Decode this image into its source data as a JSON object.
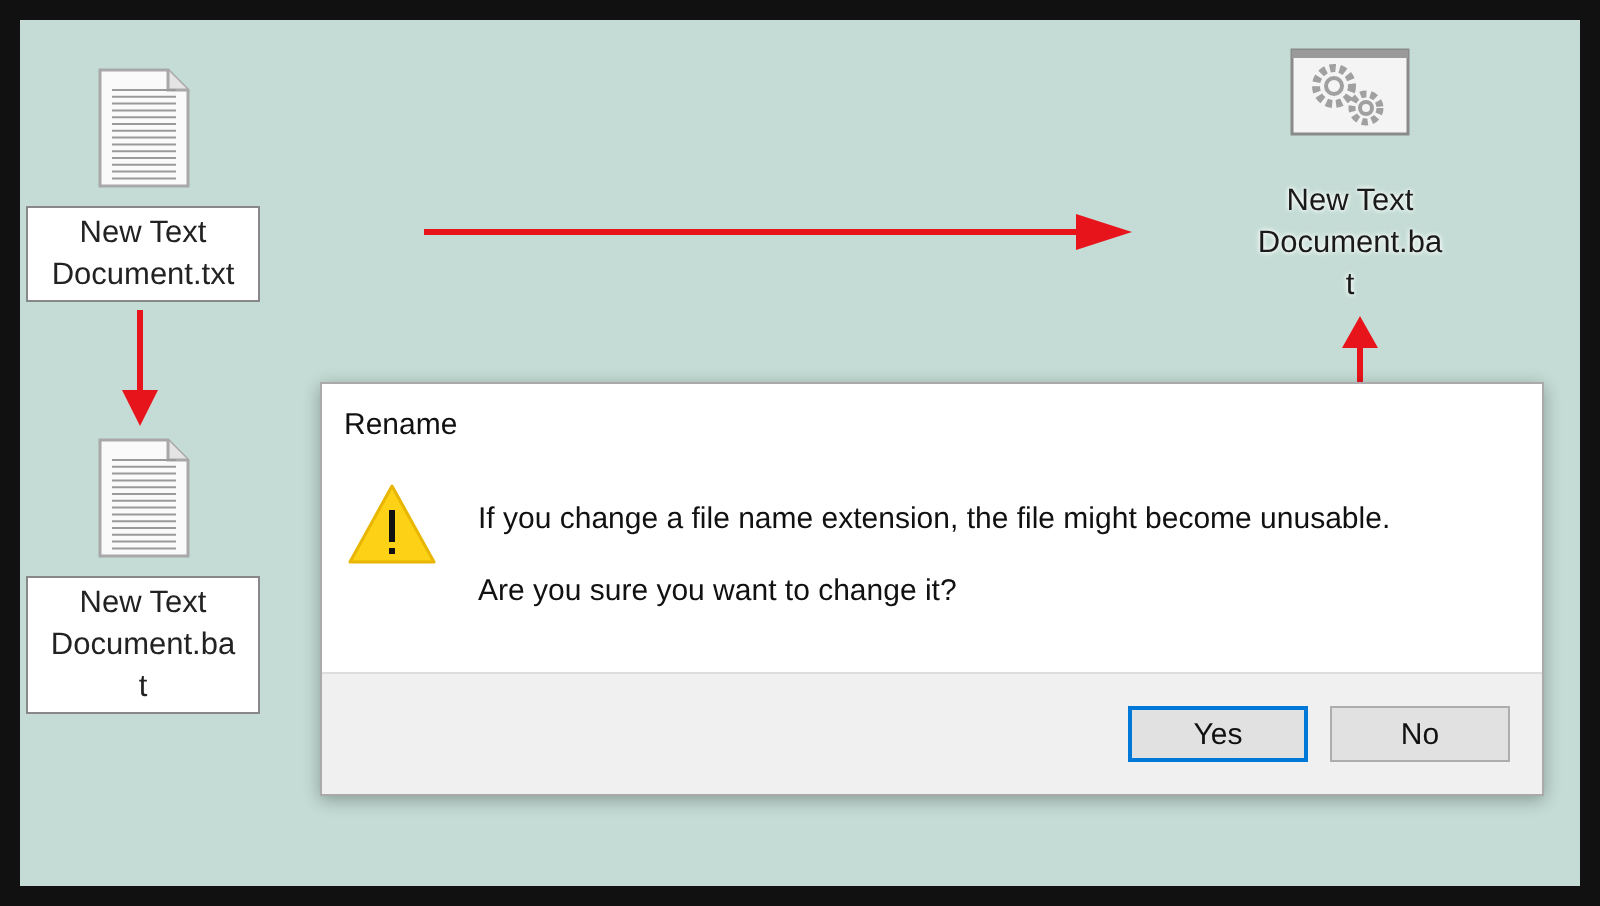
{
  "desktop_icons": [
    {
      "kind": "text",
      "label": "New Text Document.txt",
      "editing": true
    },
    {
      "kind": "text",
      "label": "New Text Document.ba\nt",
      "editing": true
    },
    {
      "kind": "batch",
      "label": "New Text Document.ba\nt",
      "editing": false
    }
  ],
  "dialog": {
    "title": "Rename",
    "message": "If you change a file name extension, the file might become unusable.",
    "question": "Are you sure you want to change it?",
    "buttons": [
      {
        "label": "Yes",
        "default": true
      },
      {
        "label": "No",
        "default": false
      }
    ]
  }
}
